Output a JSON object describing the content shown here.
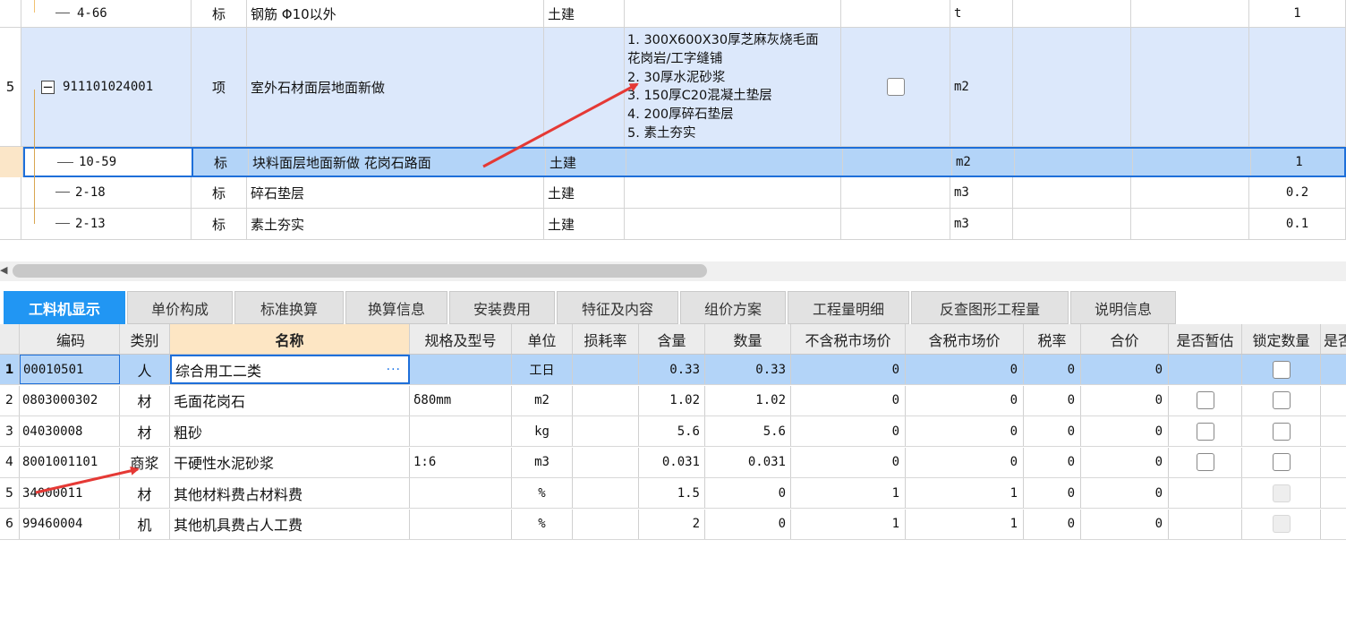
{
  "top_rows": [
    {
      "idx": "",
      "code": "4-66",
      "type": "标",
      "name": "钢筋 Φ10以外",
      "spec": "土建",
      "features": "",
      "unit": "t",
      "qty": "1"
    },
    {
      "idx": "5",
      "code": "911101024001",
      "type": "项",
      "name": "室外石材面层地面新做",
      "spec": "",
      "features": "1. 300X600X30厚芝麻灰烧毛面\n花岗岩/工字缝铺\n2. 30厚水泥砂浆\n3. 150厚C20混凝土垫层\n4. 200厚碎石垫层\n5. 素土夯实",
      "unit": "m2",
      "qty": "",
      "expand_symbol": "−"
    },
    {
      "idx": "",
      "code": "10-59",
      "type": "标",
      "name": "块料面层地面新做 花岗石路面",
      "spec": "土建",
      "features": "",
      "unit": "m2",
      "qty": "1"
    },
    {
      "idx": "",
      "code": "2-18",
      "type": "标",
      "name": "碎石垫层",
      "spec": "土建",
      "features": "",
      "unit": "m3",
      "qty": "0.2"
    },
    {
      "idx": "",
      "code": "2-13",
      "type": "标",
      "name": "素土夯实",
      "spec": "土建",
      "features": "",
      "unit": "m3",
      "qty": "0.1"
    }
  ],
  "tabs": [
    {
      "label": "工料机显示",
      "active": true
    },
    {
      "label": "单价构成"
    },
    {
      "label": "标准换算"
    },
    {
      "label": "换算信息"
    },
    {
      "label": "安装费用"
    },
    {
      "label": "特征及内容"
    },
    {
      "label": "组价方案"
    },
    {
      "label": "工程量明细"
    },
    {
      "label": "反查图形工程量"
    },
    {
      "label": "说明信息"
    }
  ],
  "table_headers": [
    "编码",
    "类别",
    "名称",
    "规格及型号",
    "单位",
    "损耗率",
    "含量",
    "数量",
    "不含税市场价",
    "含税市场价",
    "税率",
    "合价",
    "是否暂估",
    "锁定数量",
    "是否"
  ],
  "table_rows": [
    {
      "idx": "1",
      "code": "00010501",
      "cat": "人",
      "name": "综合用工二类",
      "spec": "",
      "unit": "工日",
      "loss": "",
      "content": "0.33",
      "qty": "0.33",
      "price_ex": "0",
      "price_in": "0",
      "tax": "0",
      "total": "0",
      "est": "none",
      "lock": "box"
    },
    {
      "idx": "2",
      "code": "0803000302",
      "cat": "材",
      "name": "毛面花岗石",
      "spec": "δ80mm",
      "unit": "m2",
      "loss": "",
      "content": "1.02",
      "qty": "1.02",
      "price_ex": "0",
      "price_in": "0",
      "tax": "0",
      "total": "0",
      "est": "box",
      "lock": "box"
    },
    {
      "idx": "3",
      "code": "04030008",
      "cat": "材",
      "name": "粗砂",
      "spec": "",
      "unit": "kg",
      "loss": "",
      "content": "5.6",
      "qty": "5.6",
      "price_ex": "0",
      "price_in": "0",
      "tax": "0",
      "total": "0",
      "est": "box",
      "lock": "box"
    },
    {
      "idx": "4",
      "code": "8001001101",
      "cat": "商浆",
      "name": "干硬性水泥砂浆",
      "spec": "1:6",
      "unit": "m3",
      "loss": "",
      "content": "0.031",
      "qty": "0.031",
      "price_ex": "0",
      "price_in": "0",
      "tax": "0",
      "total": "0",
      "est": "box",
      "lock": "box"
    },
    {
      "idx": "5",
      "code": "34000011",
      "cat": "材",
      "name": "其他材料费占材料费",
      "spec": "",
      "unit": "%",
      "loss": "",
      "content": "1.5",
      "qty": "0",
      "price_ex": "1",
      "price_in": "1",
      "tax": "0",
      "total": "0",
      "est": "none",
      "lock": "disabled"
    },
    {
      "idx": "6",
      "code": "99460004",
      "cat": "机",
      "name": "其他机具费占人工费",
      "spec": "",
      "unit": "%",
      "loss": "",
      "content": "2",
      "qty": "0",
      "price_ex": "1",
      "price_in": "1",
      "tax": "0",
      "total": "0",
      "est": "none",
      "lock": "disabled"
    }
  ],
  "colors": {
    "accent": "#2196f3",
    "selected_row": "#b3d4f8",
    "item_row": "#dce8fb",
    "name_header": "#fde6c4",
    "annotation_arrow": "#e53935"
  },
  "icons": {
    "expand": "minus-box-icon",
    "more": "ellipsis-icon",
    "arrow": "red-arrow-annotation"
  }
}
